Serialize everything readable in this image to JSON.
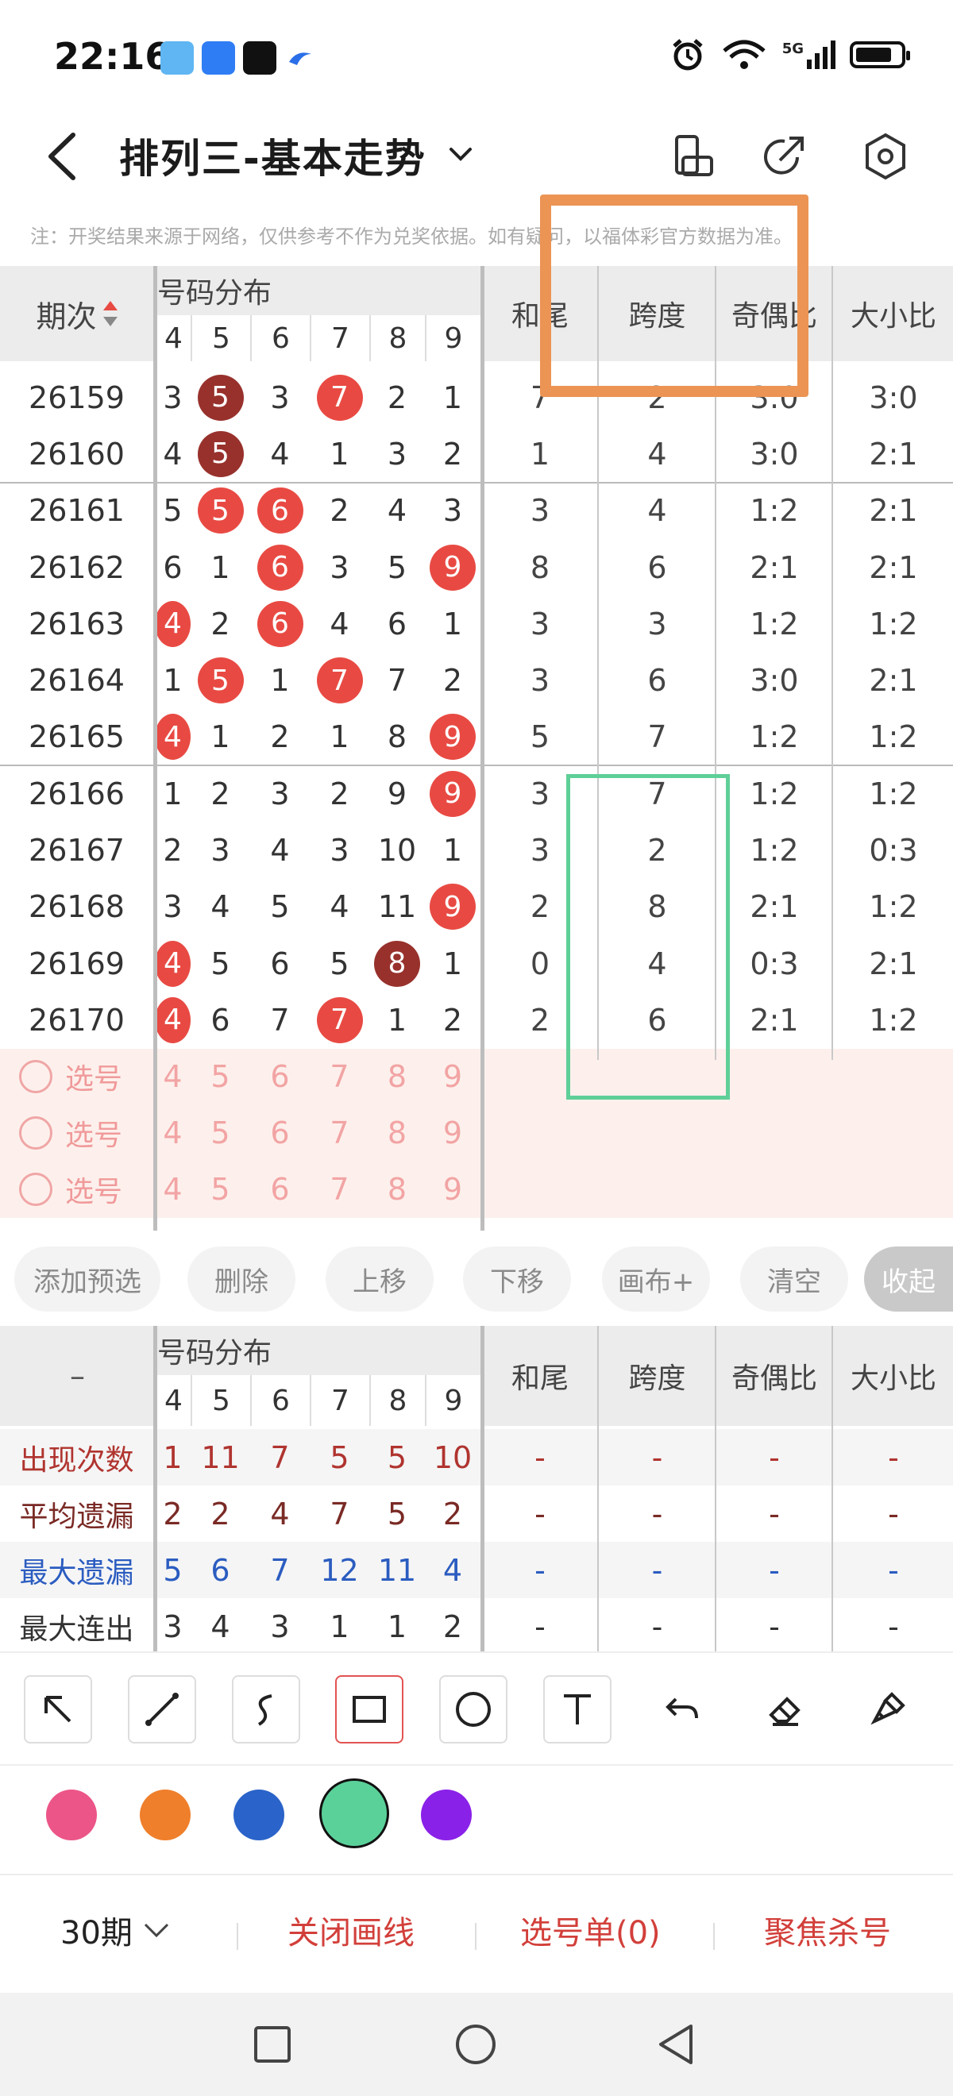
{
  "status_bar": {
    "time": "22:16",
    "network": "5G"
  },
  "header": {
    "title": "排列三-基本走势"
  },
  "notice": "注：开奖结果来源于网络，仅供参考不作为兑奖依据。如有疑问，以福体彩官方数据为准。",
  "table": {
    "period_header": "期次",
    "dist_header": "号码分布",
    "digits": [
      "4",
      "5",
      "6",
      "7",
      "8",
      "9"
    ],
    "col_heads": [
      "和尾",
      "跨度",
      "奇偶比",
      "大小比"
    ],
    "rows": [
      {
        "period": "26159",
        "d": [
          "3",
          "5",
          "3",
          "7",
          "2",
          "1"
        ],
        "b": [
          "",
          "dark",
          "",
          "red",
          "",
          ""
        ],
        "hw": "7",
        "kd": "2",
        "jo": "3:0",
        "dx": "3:0"
      },
      {
        "period": "26160",
        "d": [
          "4",
          "5",
          "4",
          "1",
          "3",
          "2"
        ],
        "b": [
          "",
          "dark",
          "",
          "",
          "",
          ""
        ],
        "hw": "1",
        "kd": "4",
        "jo": "3:0",
        "dx": "2:1"
      },
      {
        "period": "26161",
        "d": [
          "5",
          "5",
          "6",
          "2",
          "4",
          "3"
        ],
        "b": [
          "",
          "red",
          "red",
          "",
          "",
          ""
        ],
        "hw": "3",
        "kd": "4",
        "jo": "1:2",
        "dx": "2:1"
      },
      {
        "period": "26162",
        "d": [
          "6",
          "1",
          "6",
          "3",
          "5",
          "9"
        ],
        "b": [
          "",
          "",
          "red",
          "",
          "",
          "red"
        ],
        "hw": "8",
        "kd": "6",
        "jo": "2:1",
        "dx": "2:1"
      },
      {
        "period": "26163",
        "d": [
          "4",
          "2",
          "6",
          "4",
          "6",
          "1"
        ],
        "b": [
          "red",
          "",
          "red",
          "",
          "",
          ""
        ],
        "hw": "3",
        "kd": "3",
        "jo": "1:2",
        "dx": "1:2"
      },
      {
        "period": "26164",
        "d": [
          "1",
          "5",
          "1",
          "7",
          "7",
          "2"
        ],
        "b": [
          "",
          "red",
          "",
          "red",
          "",
          ""
        ],
        "hw": "3",
        "kd": "6",
        "jo": "3:0",
        "dx": "2:1"
      },
      {
        "period": "26165",
        "d": [
          "4",
          "1",
          "2",
          "1",
          "8",
          "9"
        ],
        "b": [
          "red",
          "",
          "",
          "",
          "",
          "red"
        ],
        "hw": "5",
        "kd": "7",
        "jo": "1:2",
        "dx": "1:2"
      },
      {
        "period": "26166",
        "d": [
          "1",
          "2",
          "3",
          "2",
          "9",
          "9"
        ],
        "b": [
          "",
          "",
          "",
          "",
          "",
          "red"
        ],
        "hw": "3",
        "kd": "7",
        "jo": "1:2",
        "dx": "1:2"
      },
      {
        "period": "26167",
        "d": [
          "2",
          "3",
          "4",
          "3",
          "10",
          "1"
        ],
        "b": [
          "",
          "",
          "",
          "",
          "",
          ""
        ],
        "hw": "3",
        "kd": "2",
        "jo": "1:2",
        "dx": "0:3"
      },
      {
        "period": "26168",
        "d": [
          "3",
          "4",
          "5",
          "4",
          "11",
          "9"
        ],
        "b": [
          "",
          "",
          "",
          "",
          "",
          "red"
        ],
        "hw": "2",
        "kd": "8",
        "jo": "2:1",
        "dx": "1:2"
      },
      {
        "period": "26169",
        "d": [
          "4",
          "5",
          "6",
          "5",
          "8",
          "1"
        ],
        "b": [
          "red",
          "",
          "",
          "",
          "dark",
          ""
        ],
        "hw": "0",
        "kd": "4",
        "jo": "0:3",
        "dx": "2:1"
      },
      {
        "period": "26170",
        "d": [
          "4",
          "6",
          "7",
          "7",
          "1",
          "2"
        ],
        "b": [
          "red",
          "",
          "",
          "red",
          "",
          ""
        ],
        "hw": "2",
        "kd": "6",
        "jo": "2:1",
        "dx": "1:2"
      }
    ],
    "select_label": "选号",
    "select_digits": [
      "4",
      "5",
      "6",
      "7",
      "8",
      "9"
    ]
  },
  "buttons": [
    "添加预选",
    "删除",
    "上移",
    "下移",
    "画布+",
    "清空",
    "收起"
  ],
  "stats": {
    "dash": "–",
    "rows": [
      {
        "label": "出现次数",
        "color": "#b0342f",
        "vals": [
          "1",
          "11",
          "7",
          "5",
          "5",
          "10"
        ],
        "rest": [
          "-",
          "-",
          "-",
          "-"
        ]
      },
      {
        "label": "平均遗漏",
        "color": "#7a2a25",
        "vals": [
          "2",
          "2",
          "4",
          "7",
          "5",
          "2"
        ],
        "rest": [
          "-",
          "-",
          "-",
          "-"
        ]
      },
      {
        "label": "最大遗漏",
        "color": "#2b5cc0",
        "vals": [
          "5",
          "6",
          "7",
          "12",
          "11",
          "4"
        ],
        "rest": [
          "-",
          "-",
          "-",
          "-"
        ]
      },
      {
        "label": "最大连出",
        "color": "#333333",
        "vals": [
          "3",
          "4",
          "3",
          "1",
          "1",
          "2"
        ],
        "rest": [
          "-",
          "-",
          "-",
          "-"
        ]
      }
    ]
  },
  "palette": [
    "#ec5588",
    "#ef7f2b",
    "#2a63c9",
    "#5bd19a",
    "#8a21e8"
  ],
  "bottom_bar": {
    "period": "30期",
    "close": "关闭画线",
    "select": "选号单(0)",
    "focus": "聚焦杀号"
  }
}
